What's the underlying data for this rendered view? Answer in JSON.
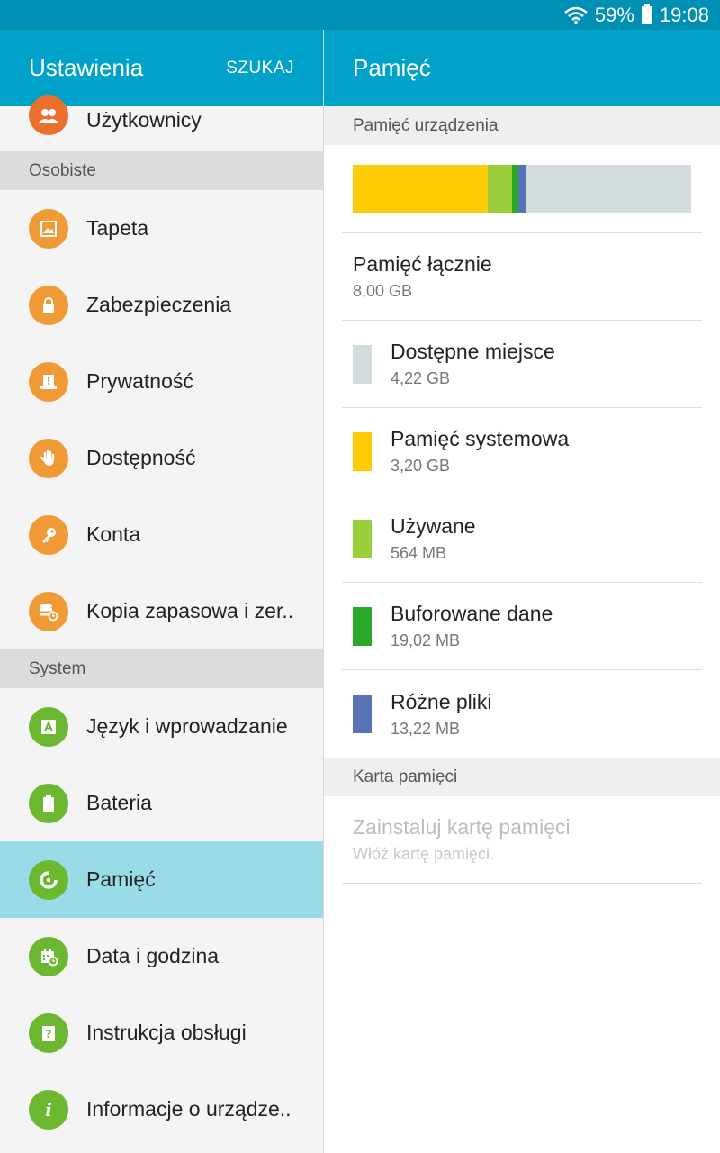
{
  "status_bar": {
    "battery": "59%",
    "time": "19:08"
  },
  "left_panel": {
    "title": "Ustawienia",
    "search_label": "SZUKAJ",
    "top_item": "Użytkownicy",
    "section_personal": "Osobiste",
    "personal_items": [
      "Tapeta",
      "Zabezpieczenia",
      "Prywatność",
      "Dostępność",
      "Konta",
      "Kopia zapasowa i zer.."
    ],
    "section_system": "System",
    "system_items": [
      "Język i wprowadzanie",
      "Bateria",
      "Pamięć",
      "Data i godzina",
      "Instrukcja obsługi",
      "Informacje o urządze.."
    ],
    "active_item": "Pamięć"
  },
  "right_panel": {
    "title": "Pamięć",
    "device_storage_header": "Pamięć urządzenia",
    "total_label": "Pamięć łącznie",
    "total_value": "8,00 GB",
    "storage_items": [
      {
        "label": "Dostępne miejsce",
        "value": "4,22 GB",
        "color": "#d5dcdd"
      },
      {
        "label": "Pamięć systemowa",
        "value": "3,20 GB",
        "color": "#ffcb05"
      },
      {
        "label": "Używane",
        "value": "564 MB",
        "color": "#99cf3a"
      },
      {
        "label": "Buforowane dane",
        "value": "19,02 MB",
        "color": "#2ba82a"
      },
      {
        "label": "Różne pliki",
        "value": "13,22 MB",
        "color": "#5673b5"
      }
    ],
    "bar_fractions": {
      "system": 0.4,
      "used": 0.07,
      "cached": 0.02,
      "misc": 0.02,
      "free": 0.49
    },
    "card_header": "Karta pamięci",
    "card_label": "Zainstaluj kartę pamięci",
    "card_sub": "Włóż kartę pamięci."
  },
  "colors": {
    "accent": "#00a2c9",
    "active_row": "#9adbe8",
    "icon_orange": "#f09a36",
    "icon_green": "#6bb72f"
  }
}
